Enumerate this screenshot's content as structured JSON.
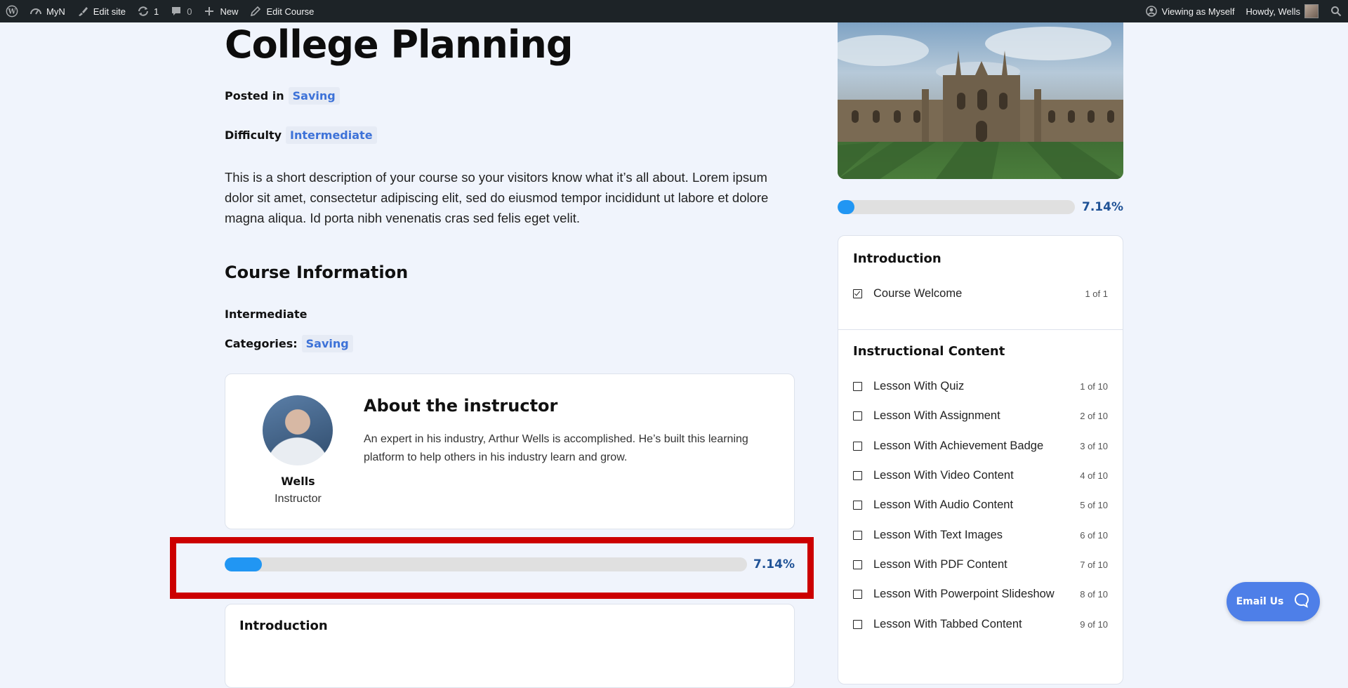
{
  "adminbar": {
    "site_name": "MyN",
    "edit_site": "Edit site",
    "updates_count": "1",
    "comments_count": "0",
    "new_label": "New",
    "edit_course": "Edit Course",
    "viewing_as": "Viewing as Myself",
    "howdy": "Howdy, Wells"
  },
  "course": {
    "title": "College Planning",
    "posted_in_label": "Posted in",
    "posted_in_value": "Saving",
    "difficulty_label": "Difficulty",
    "difficulty_value": "Intermediate",
    "description": "This is a short description of your course so your visitors know what it’s all about. Lorem ipsum dolor sit amet, consectetur adipiscing elit, sed do eiusmod tempor incididunt ut labore et dolore magna aliqua. Id porta nibh venenatis cras sed felis eget velit.",
    "info_heading": "Course Information",
    "level": "Intermediate",
    "categories_label": "Categories:",
    "categories_value": "Saving"
  },
  "instructor": {
    "heading": "About the instructor",
    "name": "Wells",
    "role": "Instructor",
    "bio": "An expert in his industry, Arthur Wells is accomplished. He’s built this learning platform to help others in his industry learn and grow."
  },
  "progress": {
    "percent_label": "7.14%",
    "fraction": 0.0714
  },
  "main_outline": {
    "first_section": "Introduction"
  },
  "sidebar": {
    "progress_label": "7.14%",
    "sections": [
      {
        "title": "Introduction",
        "lessons": [
          {
            "title": "Course Welcome",
            "count": "1 of 1",
            "done": true
          }
        ]
      },
      {
        "title": "Instructional Content",
        "lessons": [
          {
            "title": "Lesson With Quiz",
            "count": "1 of 10",
            "done": false
          },
          {
            "title": "Lesson With Assignment",
            "count": "2 of 10",
            "done": false
          },
          {
            "title": "Lesson With Achievement Badge",
            "count": "3 of 10",
            "done": false
          },
          {
            "title": "Lesson With Video Content",
            "count": "4 of 10",
            "done": false
          },
          {
            "title": "Lesson With Audio Content",
            "count": "5 of 10",
            "done": false
          },
          {
            "title": "Lesson With Text Images",
            "count": "6 of 10",
            "done": false
          },
          {
            "title": "Lesson With PDF Content",
            "count": "7 of 10",
            "done": false
          },
          {
            "title": "Lesson With Powerpoint Slideshow",
            "count": "8 of 10",
            "done": false
          },
          {
            "title": "Lesson With Tabbed Content",
            "count": "9 of 10",
            "done": false
          }
        ]
      }
    ]
  },
  "support": {
    "email_label": "Email Us"
  },
  "colors": {
    "accent": "#2196f3",
    "tag_text": "#3d72d8",
    "percent_text": "#1f5296",
    "highlight": "#cc0000",
    "email_button": "#4e7fe8"
  }
}
